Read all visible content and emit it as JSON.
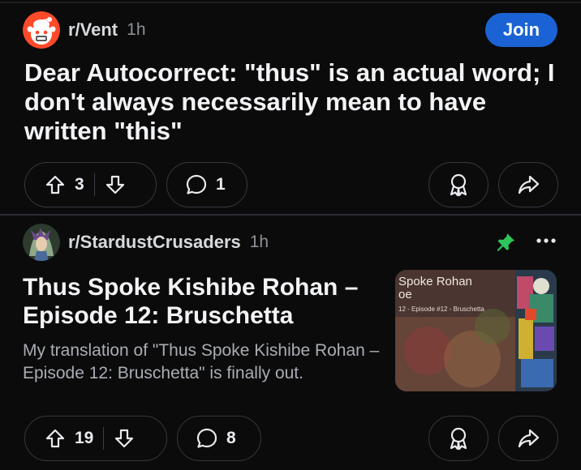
{
  "posts": [
    {
      "subreddit": "r/Vent",
      "time": "1h",
      "join_label": "Join",
      "title": "Dear Autocorrect: \"thus\" is an actual word; I don't always necessarily mean to have written \"this\"",
      "upvotes": "3",
      "comments": "1",
      "icons": [
        "upvote-icon",
        "downvote-icon",
        "comment-icon",
        "award-icon",
        "share-icon"
      ]
    },
    {
      "subreddit": "r/StardustCrusaders",
      "time": "1h",
      "title": "Thus Spoke Kishibe Rohan – Episode 12: Bruschetta",
      "body": "My translation of \"Thus Spoke Kishibe Rohan – Episode 12: Bruschetta\" is finally out.",
      "thumbnail": {
        "title_line1": "Spoke Rohan",
        "title_line2": "oe",
        "subtitle": "12 - Episode #12 - Bruschetta"
      },
      "upvotes": "19",
      "comments": "8",
      "icons": [
        "pin-icon",
        "more-options-icon",
        "upvote-icon",
        "downvote-icon",
        "comment-icon",
        "award-icon",
        "share-icon"
      ]
    }
  ],
  "colors": {
    "background": "#0b0b0c",
    "join_button": "#1b63d4",
    "pin": "#2fc45a",
    "muted_text": "#8d9196"
  }
}
